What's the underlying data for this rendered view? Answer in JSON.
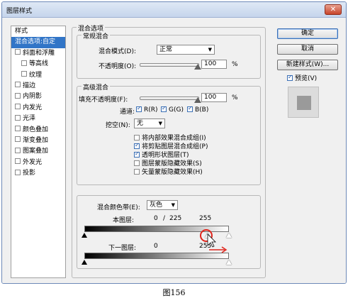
{
  "window": {
    "title": "图层样式",
    "close_glyph": "✕"
  },
  "sidebar": {
    "items": [
      {
        "label": "样式",
        "type": "header"
      },
      {
        "label": "混合选项:自定",
        "type": "active"
      },
      {
        "label": "斜面和浮雕",
        "type": "check"
      },
      {
        "label": "等高线",
        "type": "sub"
      },
      {
        "label": "纹理",
        "type": "sub"
      },
      {
        "label": "描边",
        "type": "check"
      },
      {
        "label": "内阴影",
        "type": "check"
      },
      {
        "label": "内发光",
        "type": "check"
      },
      {
        "label": "光泽",
        "type": "check"
      },
      {
        "label": "颜色叠加",
        "type": "check"
      },
      {
        "label": "渐变叠加",
        "type": "check"
      },
      {
        "label": "图案叠加",
        "type": "check"
      },
      {
        "label": "外发光",
        "type": "check"
      },
      {
        "label": "投影",
        "type": "check"
      }
    ]
  },
  "blend_options": {
    "title": "混合选项",
    "general": {
      "title": "常规混合",
      "mode_label": "混合模式(D):",
      "mode_value": "正常",
      "opacity_label": "不透明度(O):",
      "opacity_value": "100",
      "percent": "%"
    },
    "advanced": {
      "title": "高级混合",
      "fill_label": "填充不透明度(F):",
      "fill_value": "100",
      "percent": "%",
      "channels_label": "通道:",
      "channel_r": "R(R)",
      "channel_g": "G(G)",
      "channel_b": "B(B)",
      "knockout_label": "挖空(N):",
      "knockout_value": "无",
      "options": [
        {
          "label": "将内部效果混合成组(I)",
          "checked": false
        },
        {
          "label": "将剪贴图层混合成组(P)",
          "checked": true
        },
        {
          "label": "透明形状图层(T)",
          "checked": true
        },
        {
          "label": "图层蒙版隐藏效果(S)",
          "checked": false
        },
        {
          "label": "矢量蒙版隐藏效果(H)",
          "checked": false
        }
      ]
    },
    "blend_if": {
      "label": "混合颜色带(E):",
      "value": "灰色",
      "this_layer_label": "本图层:",
      "this_layer_low": "0",
      "this_layer_slash": "/",
      "this_layer_split": "225",
      "this_layer_high": "255",
      "under_layer_label": "下一图层:",
      "under_layer_low": "0",
      "under_layer_high": "255"
    }
  },
  "buttons": {
    "ok": "确定",
    "cancel": "取消",
    "new_style": "新建样式(W)...",
    "preview_label": "预览(V)"
  },
  "caption": "图156",
  "colors": {
    "accent": "#3175c7",
    "annotation": "#e0241b"
  }
}
